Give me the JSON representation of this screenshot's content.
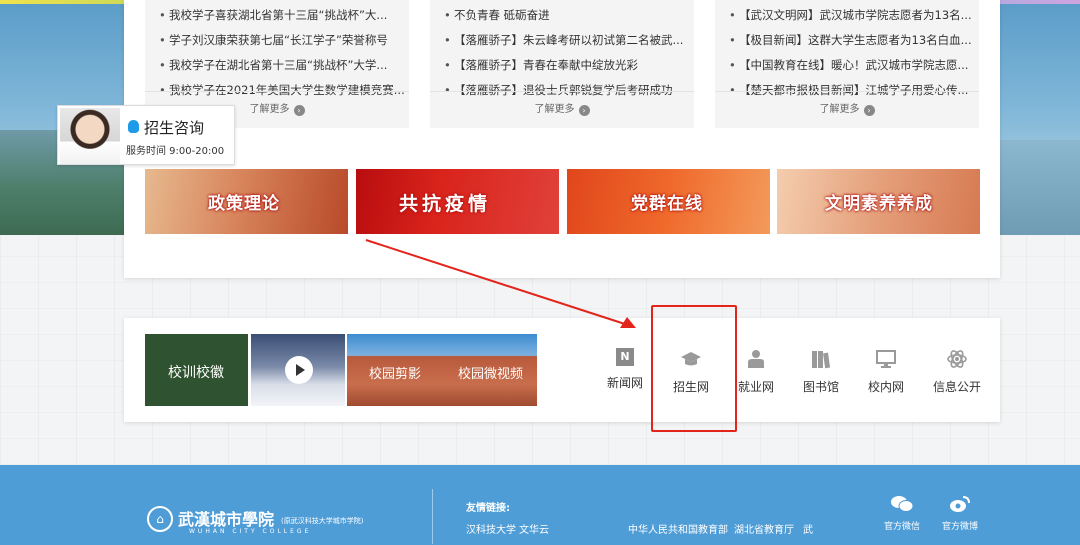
{
  "news_columns": [
    {
      "items": [
        "我校学子喜获湖北省第十三届“挑战杯”大...",
        "学子刘汉康荣获第七届“长江学子”荣誉称号",
        "我校学子在湖北省第十三届“挑战杯”大学...",
        "我校学子在2021年美国大学生数学建模竞赛..."
      ],
      "more": "了解更多"
    },
    {
      "items": [
        "不负青春 砥砺奋进",
        "【落雁骄子】朱云峰考研以初试第二名被武...",
        "【落雁骄子】青春在奉献中绽放光彩",
        "【落雁骄子】退役士兵郭锐复学后考研成功"
      ],
      "more": "了解更多"
    },
    {
      "items": [
        "【武汉文明网】武汉城市学院志愿者为13名...",
        "【极目新闻】这群大学生志愿者为13名白血...",
        "【中国教育在线】暖心！武汉城市学院志愿...",
        "【楚天都市报极目新闻】江城学子用爱心传..."
      ],
      "more": "了解更多"
    }
  ],
  "banners": [
    "政策理论",
    "共抗疫情",
    "党群在线",
    "文明素养养成"
  ],
  "consult": {
    "title": "招生咨询",
    "hours": "服务时间 9:00-20:00"
  },
  "media_tiles": {
    "motto": "校训校徽",
    "campus_photos": "校园剪影",
    "campus_video": "校园微视频"
  },
  "quick_links": [
    {
      "label": "新闻网",
      "icon": "news-icon"
    },
    {
      "label": "招生网",
      "icon": "graduation-cap-icon"
    },
    {
      "label": "就业网",
      "icon": "employment-icon"
    },
    {
      "label": "图书馆",
      "icon": "books-icon"
    },
    {
      "label": "校内网",
      "icon": "monitor-icon"
    },
    {
      "label": "信息公开",
      "icon": "atom-icon"
    }
  ],
  "footer": {
    "school_name": "武漢城市學院",
    "school_sub": "(原武汉科技大学城市学院)",
    "school_en": "WUHAN CITY COLLEGE",
    "links_title": "友情链接:",
    "links": [
      "汉科技大学",
      "文华云",
      "中华人民共和国教育部",
      "湖北省教育厅",
      "武"
    ],
    "social": [
      {
        "label": "官方微信",
        "icon": "wechat-icon"
      },
      {
        "label": "官方微博",
        "icon": "weibo-icon"
      }
    ]
  },
  "colors": {
    "footer_bg": "#4f9dd7",
    "highlight_box": "#e3241b",
    "annotation_arrow": "#e3241b"
  }
}
